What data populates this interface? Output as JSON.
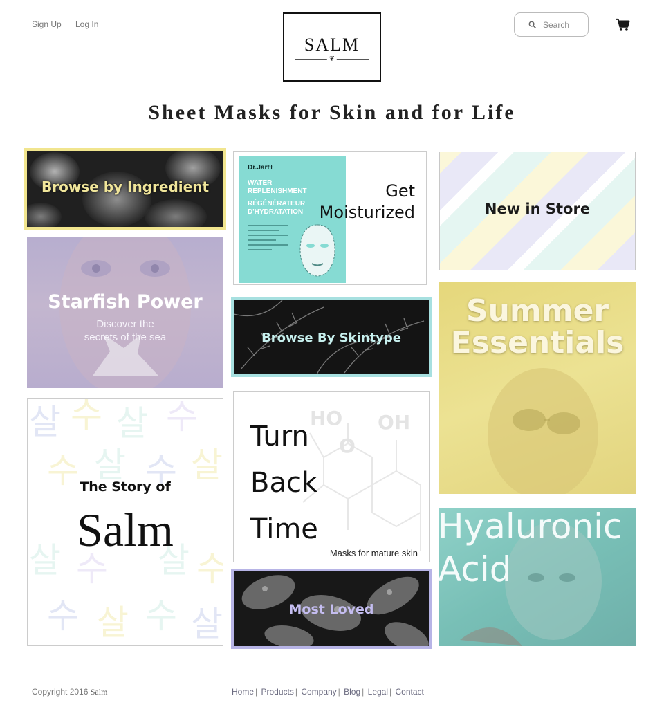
{
  "header": {
    "sign_up": "Sign Up",
    "log_in": "Log In",
    "logo_text": "SALM",
    "search_placeholder": "Search",
    "cart_icon": "cart-icon"
  },
  "page_title": "Sheet Masks for Skin and for Life",
  "tiles": {
    "ingredient": {
      "label": "Browse by Ingredient",
      "border_color": "#f1e58e"
    },
    "moisturized": {
      "line1": "Get",
      "line2": "Moisturized",
      "pack_brand": "Dr.Jart+",
      "pack_title1": "WATER",
      "pack_title2": "REPLENISHMENT",
      "pack_sub1": "RÉGÉNÉRATEUR",
      "pack_sub2": "D'HYDRATATION"
    },
    "new_in_store": {
      "label": "New in Store"
    },
    "starfish": {
      "title": "Starfish Power",
      "sub1": "Discover the",
      "sub2": "secrets of the sea"
    },
    "skintype": {
      "label": "Browse By Skintype",
      "border_color": "#a7e0e0"
    },
    "summer": {
      "line1": "Summer",
      "line2": "Essentials"
    },
    "story": {
      "line1": "The Story of",
      "line2": "Salm"
    },
    "turn_back": {
      "line1": "Turn",
      "line2": "Back",
      "line3": "Time",
      "caption": "Masks for mature skin",
      "chem1": "HO",
      "chem2": "OH",
      "chem3": "O"
    },
    "hyaluronic": {
      "line1": "Hyaluronic",
      "line2": "Acid"
    },
    "most_loved": {
      "label": "Most Loved",
      "border_color": "#b7b4e6"
    }
  },
  "footer": {
    "copyright": "Copyright 2016",
    "brand": "Salm",
    "links": [
      "Home",
      "Products",
      "Company",
      "Blog",
      "Legal",
      "Contact"
    ]
  }
}
